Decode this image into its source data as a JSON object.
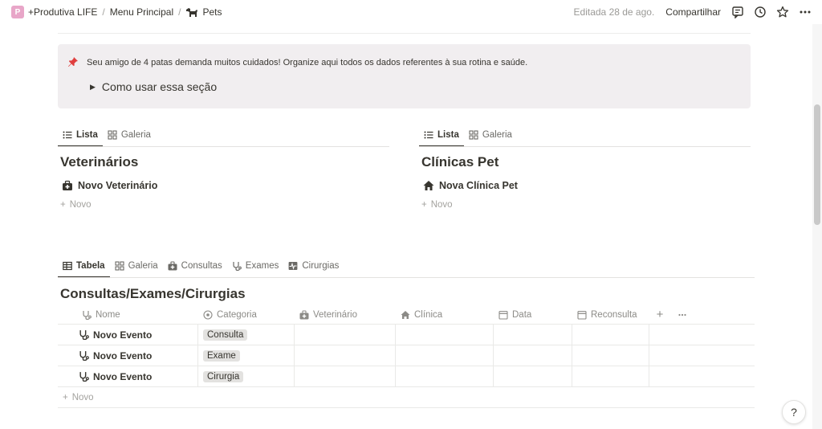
{
  "breadcrumb": {
    "workspace_initial": "P",
    "items": [
      "+Produtiva LIFE",
      "Menu Principal",
      "Pets"
    ],
    "separator": "/"
  },
  "topbar": {
    "edited": "Editada 28 de ago.",
    "share": "Compartilhar"
  },
  "callout": {
    "text": "Seu amigo de 4 patas demanda muitos cuidados! Organize aqui todos os dados referentes à sua rotina e saúde.",
    "toggle_label": "Como usar essa seção"
  },
  "vets": {
    "tabs": [
      "Lista",
      "Galeria"
    ],
    "title": "Veterinários",
    "item": "Novo Veterinário",
    "new": "Novo"
  },
  "clinics": {
    "tabs": [
      "Lista",
      "Galeria"
    ],
    "title": "Clínicas Pet",
    "item": "Nova Clínica Pet",
    "new": "Novo"
  },
  "events": {
    "tabs": [
      "Tabela",
      "Galeria",
      "Consultas",
      "Exames",
      "Cirurgias"
    ],
    "title": "Consultas/Exames/Cirurgias",
    "columns": [
      "Nome",
      "Categoria",
      "Veterinário",
      "Clínica",
      "Data",
      "Reconsulta"
    ],
    "rows": [
      {
        "name": "Novo Evento",
        "category": "Consulta"
      },
      {
        "name": "Novo Evento",
        "category": "Exame"
      },
      {
        "name": "Novo Evento",
        "category": "Cirurgia"
      }
    ],
    "new": "Novo"
  },
  "help": {
    "label": "?"
  },
  "colors": {
    "callout_bg": "#f1eef0",
    "workspace_icon": "#e8a6c8",
    "tag_bg": "#e3e2e0",
    "pin": "#e03e3e"
  }
}
